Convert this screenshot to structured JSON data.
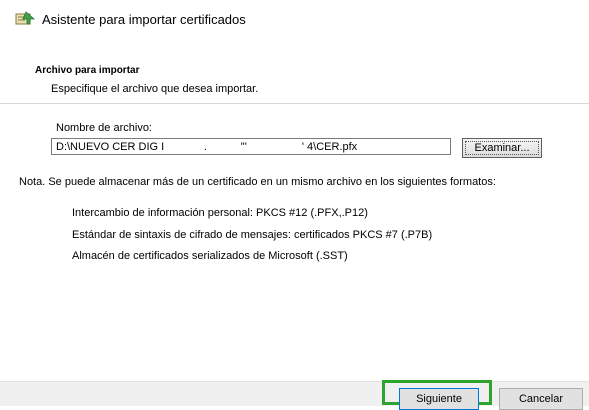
{
  "window": {
    "title": "Asistente para importar certificados",
    "icon": "certificate-wizard-icon"
  },
  "section": {
    "title": "Archivo para importar",
    "subtitle": "Especifique el archivo que desea importar."
  },
  "file": {
    "label": "Nombre de archivo:",
    "value": "D:\\NUEVO CER DIG I             .           '''                  ' 4\\CER.pfx",
    "browse_label": "Examinar..."
  },
  "note": {
    "text": "Nota. Se puede almacenar más de un certificado en un mismo archivo en los siguientes formatos:",
    "formats": [
      "Intercambio de información personal: PKCS #12 (.PFX,.P12)",
      "Estándar de sintaxis de cifrado de mensajes: certificados PKCS #7 (.P7B)",
      "Almacén de certificados serializados de Microsoft (.SST)"
    ]
  },
  "footer": {
    "next_label": "Siguiente",
    "cancel_label": "Cancelar",
    "highlight_color": "#2fa32f"
  }
}
